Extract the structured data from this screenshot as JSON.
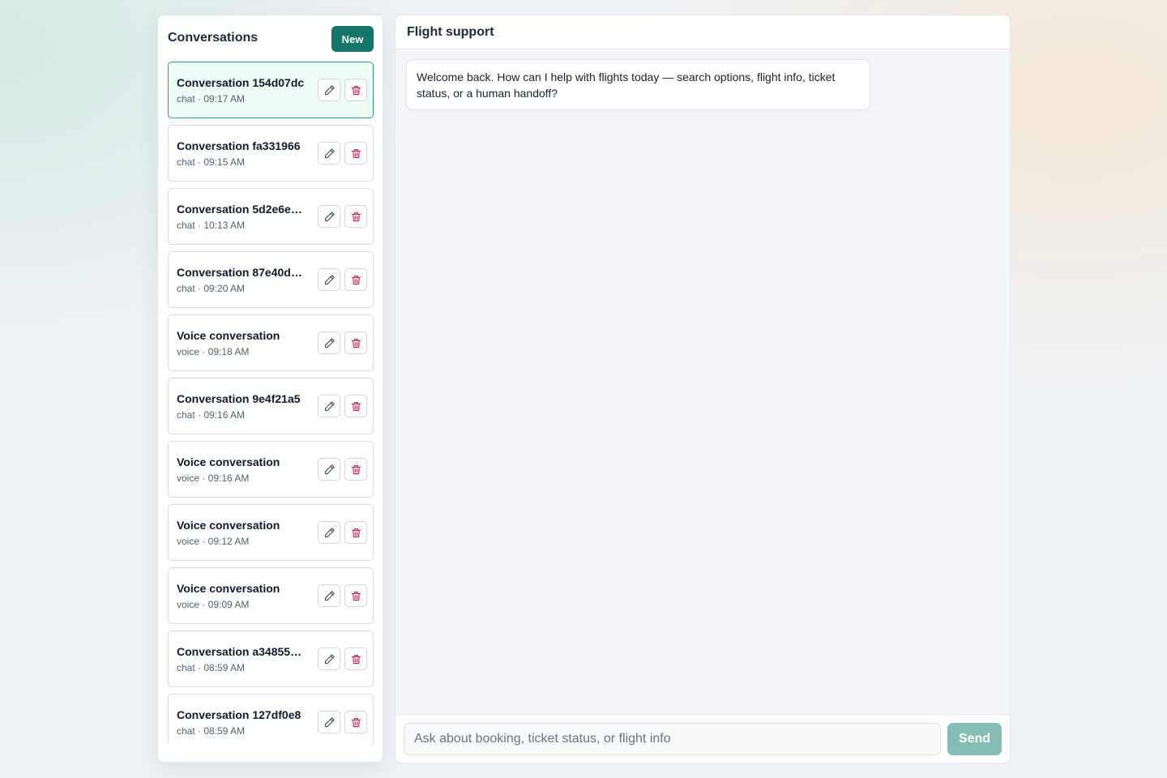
{
  "sidebar": {
    "title": "Conversations",
    "new_label": "New",
    "conversations": [
      {
        "title": "Conversation 154d07dc",
        "meta": "chat · 09:17 AM",
        "active": true
      },
      {
        "title": "Conversation fa331966",
        "meta": "chat · 09:15 AM"
      },
      {
        "title": "Conversation 5d2e6e…",
        "meta": "chat · 10:13 AM"
      },
      {
        "title": "Conversation 87e40d…",
        "meta": "chat · 09:20 AM"
      },
      {
        "title": "Voice conversation",
        "meta": "voice · 09:18 AM"
      },
      {
        "title": "Conversation 9e4f21a5",
        "meta": "chat · 09:16 AM"
      },
      {
        "title": "Voice conversation",
        "meta": "voice · 09:16 AM"
      },
      {
        "title": "Voice conversation",
        "meta": "voice · 09:12 AM"
      },
      {
        "title": "Voice conversation",
        "meta": "voice · 09:09 AM"
      },
      {
        "title": "Conversation a34855…",
        "meta": "chat · 08:59 AM"
      },
      {
        "title": "Conversation 127df0e8",
        "meta": "chat · 08:59 AM"
      }
    ]
  },
  "chat": {
    "title": "Flight support",
    "messages": [
      {
        "role": "assistant",
        "text": "Welcome back. How can I help with flights today — search options, flight info, ticket status, or a human handoff?"
      }
    ],
    "input": {
      "value": "",
      "placeholder": "Ask about booking, ticket status, or flight info"
    },
    "send_label": "Send"
  },
  "icons": {
    "edit": "pencil-icon",
    "delete": "trash-icon"
  },
  "colors": {
    "accent": "#14766a",
    "active_bg": "#eefcf6",
    "active_border": "#2f9b86",
    "delete": "#c0264b",
    "send_disabled": "#86bdb3"
  }
}
